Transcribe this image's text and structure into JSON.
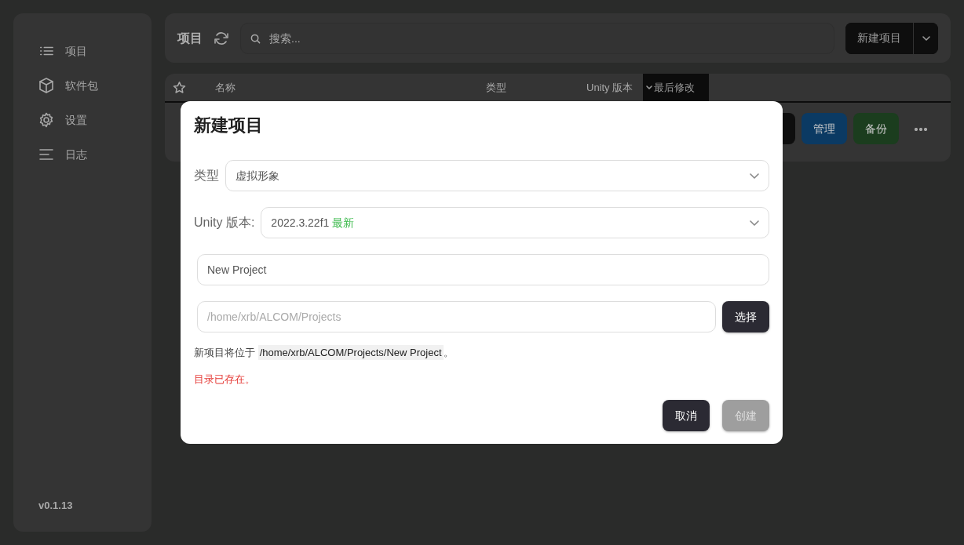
{
  "sidebar": {
    "items": [
      {
        "label": "项目"
      },
      {
        "label": "软件包"
      },
      {
        "label": "设置"
      },
      {
        "label": "日志"
      }
    ],
    "version": "v0.1.13"
  },
  "header": {
    "title": "项目",
    "search": {
      "placeholder": "搜索..."
    },
    "new_button": "新建项目"
  },
  "table": {
    "columns": [
      {
        "label": "名称",
        "sorted": false
      },
      {
        "label": "类型",
        "sorted": false
      },
      {
        "label": "Unity 版本",
        "sorted": false
      },
      {
        "label": "最后修改",
        "sorted": true
      }
    ],
    "row_buttons": [
      {
        "label": "管理",
        "color": "#0b3a63"
      },
      {
        "label": "备份",
        "color": "#1b3d1e"
      }
    ]
  },
  "dialog": {
    "title": "新建项目",
    "type": {
      "label": "类型",
      "value": "虚拟形象"
    },
    "unity": {
      "label": "Unity 版本:",
      "value": "2022.3.22f1",
      "badge": "最新"
    },
    "name": {
      "value": "New Project"
    },
    "location": {
      "placeholder": "/home/xrb/ALCOM/Projects",
      "button": "选择"
    },
    "hint": {
      "text": "新项目将位于",
      "path": "/home/xrb/ALCOM/Projects/New Project",
      "end": "。"
    },
    "error": "目录已存在。",
    "buttons": [
      {
        "label": "取消",
        "disabled": false
      },
      {
        "label": "创建",
        "disabled": true
      }
    ]
  }
}
